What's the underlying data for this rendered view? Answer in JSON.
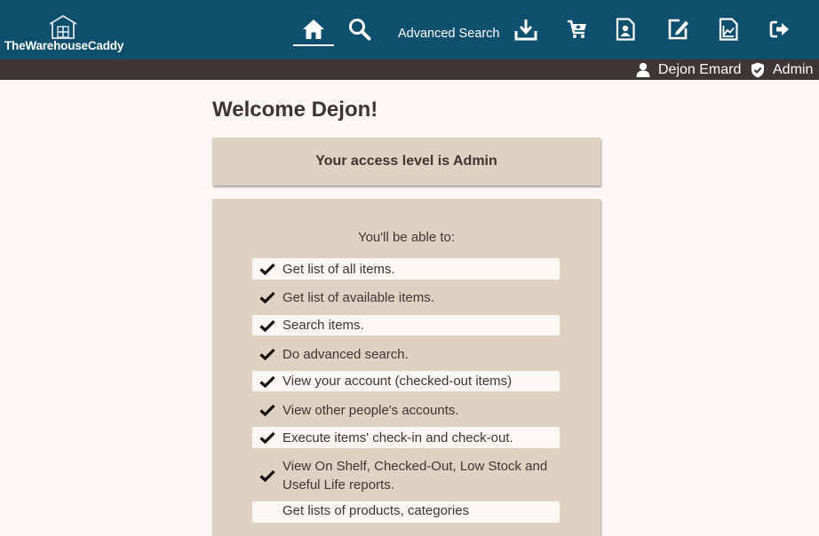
{
  "brand": {
    "name": "TheWarehouseCaddy",
    "logo_icon": "warehouse-boxes-icon"
  },
  "nav": {
    "home_icon": "home-icon",
    "search_icon": "search-icon",
    "advanced_search_label": "Advanced Search",
    "download_icon": "download-icon",
    "cart_icon": "cart-icon",
    "account_icon": "account-badge-icon",
    "edit_icon": "edit-icon",
    "reports_icon": "reports-icon",
    "logout_icon": "sign-out-icon"
  },
  "userbar": {
    "user_name": "Dejon Emard",
    "role": "Admin"
  },
  "main": {
    "welcome": "Welcome Dejon!",
    "access_level": "Your access level is Admin",
    "abilities_intro": "You'll be able to:",
    "abilities": [
      "Get list of all items.",
      "Get list of available items.",
      "Search items.",
      "Do advanced search.",
      "View your account (checked-out items)",
      "View other people's accounts.",
      "Execute items' check-in and check-out.",
      "View On Shelf, Checked-Out, Low Stock and Useful Life reports.",
      "Get lists of products, categories"
    ]
  },
  "colors": {
    "header": "#0d4f6c",
    "userbar": "#3e3535",
    "card": "#dfd2c2",
    "page_bg": "#faf7f4",
    "text": "#3f3434"
  }
}
